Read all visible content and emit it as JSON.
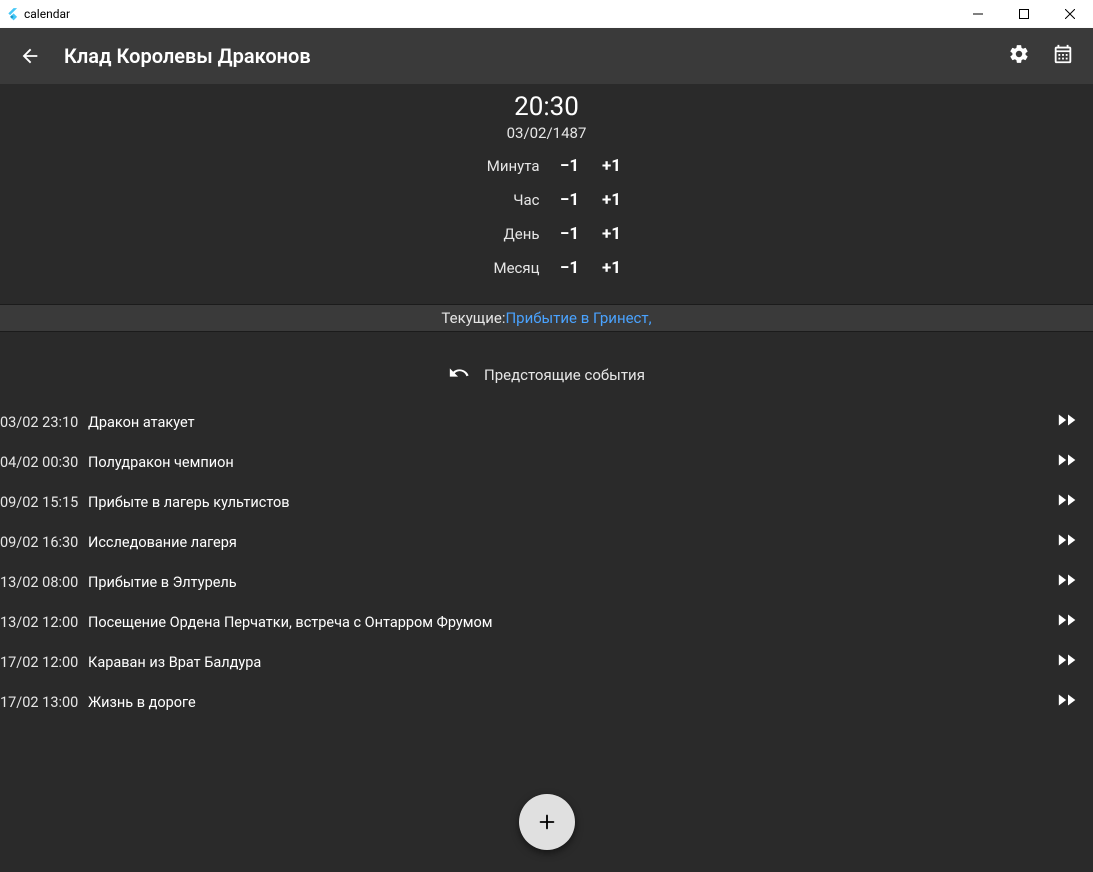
{
  "window": {
    "title": "calendar"
  },
  "appbar": {
    "title": "Клад Королевы Драконов"
  },
  "clock": {
    "time": "20:30",
    "date": "03/02/1487",
    "minus_label": "−1",
    "plus_label": "+1",
    "rows": {
      "minute": "Минута",
      "hour": "Час",
      "day": "День",
      "month": "Месяц"
    }
  },
  "current": {
    "label": "Текущие:",
    "link": "Прибытие в Гринест,"
  },
  "upcoming": {
    "header": "Предстоящие события"
  },
  "events": [
    {
      "datetime": "03/02 23:10",
      "title": "Дракон атакует"
    },
    {
      "datetime": "04/02 00:30",
      "title": "Полудракон чемпион"
    },
    {
      "datetime": "09/02 15:15",
      "title": "Прибыте в лагерь культистов"
    },
    {
      "datetime": "09/02 16:30",
      "title": "Исследование лагеря"
    },
    {
      "datetime": "13/02 08:00",
      "title": "Прибытие в Элтурель"
    },
    {
      "datetime": "13/02 12:00",
      "title": "Посещение Ордена Перчатки, встреча с Онтарром Фрумом"
    },
    {
      "datetime": "17/02 12:00",
      "title": "Караван из Врат Балдура"
    },
    {
      "datetime": "17/02 13:00",
      "title": "Жизнь в дороге"
    }
  ]
}
